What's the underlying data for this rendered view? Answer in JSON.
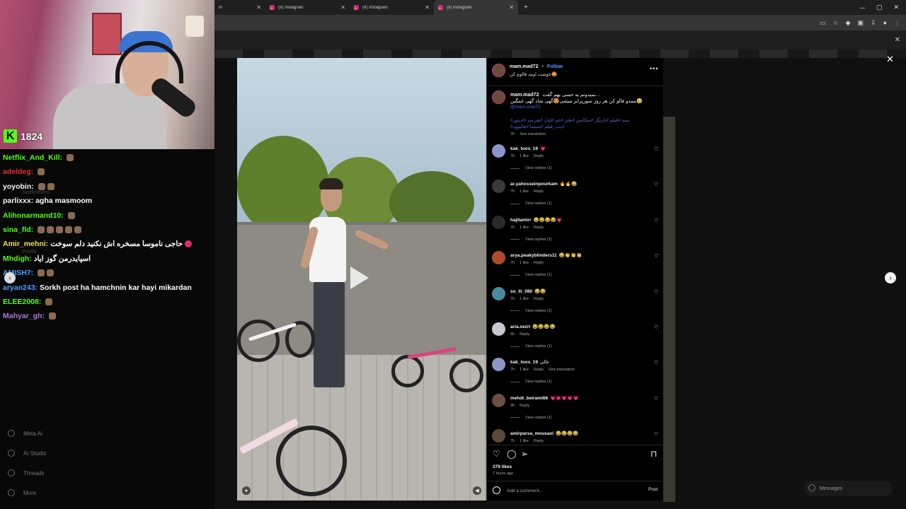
{
  "browser": {
    "tabs": [
      {
        "label": "m",
        "active": false
      },
      {
        "label": "(9) Instagram",
        "active": false
      },
      {
        "label": "(9) Instagram",
        "active": false
      },
      {
        "label": "(9) Instagram",
        "active": true
      }
    ],
    "tab_close": "✕",
    "new_tab": "+",
    "window_controls": [
      "─",
      "▢",
      "✕"
    ]
  },
  "stream": {
    "viewer_count": "1824",
    "chat": [
      {
        "user": "Netflix_And_Kill:",
        "message": "",
        "color": "#53fc18"
      },
      {
        "user": "adeldeg:",
        "message": "",
        "color": "#e03030"
      },
      {
        "user": "yoyobin:",
        "message": "",
        "color": "#f5f5f5"
      },
      {
        "user": "parlixxx:",
        "message": "agha masmoom",
        "color": "#f5f5f5"
      },
      {
        "user": "Alihonarmand10:",
        "message": "",
        "color": "#53fc18"
      },
      {
        "user": "sina_fld:",
        "message": "",
        "color": "#53fc18"
      },
      {
        "user": "Amir_mehni:",
        "message": "حاجی ناموسا مسخره اش نکنید دلم سوخت",
        "color": "#f0e060"
      },
      {
        "user": "Mhdigh:",
        "message": "اسپایدرمن گوز ایاد",
        "color": "#53fc18"
      },
      {
        "user": "AMISH7:",
        "message": "",
        "color": "#4a9dff"
      },
      {
        "user": "aryan243:",
        "message": "Sorkh post ha hamchnin kar hayi mikardan",
        "color": "#4a9dff"
      },
      {
        "user": "ELEE2008:",
        "message": "",
        "color": "#53fc18"
      },
      {
        "user": "Mahyar_gh:",
        "message": "",
        "color": "#b07ad8"
      }
    ],
    "ghost_nav": [
      "Meta AI",
      "AI Studio",
      "Threads",
      "More"
    ],
    "ghost_labels": [
      "Notifications",
      "Profile"
    ]
  },
  "post": {
    "username": "mam.mad72",
    "follow": "Follow",
    "separator": "•",
    "subtitle": "خوشت اومد فالوم کن🤩",
    "caption": {
      "user": "mam.mad72",
      "line1": "نمیدونم یه حسی بهم گفت...",
      "line2": "ممدو فالو کن هر روز سورپرایز میشی😍گهی شاد گهی غمگین🥹",
      "mention": "@mam.mad72",
      "hashtags1": "#ممد #فیلم #بازیگر #سکانس #طنز #غم #لبان #هنرمند #ادیتور",
      "hashtags2": "#ادیت_فیلم #سینما #هالیوود",
      "time": "7h",
      "see_translation": "See translation"
    },
    "comments": [
      {
        "user": "kak_toos_19",
        "text": "💗",
        "time": "7h",
        "likes": "1 like",
        "reply": "Reply",
        "translate": "",
        "view_replies": "View replies (1)"
      },
      {
        "user": "ar.yahosseinpourkam",
        "text": "🔥🔥😂",
        "time": "7h",
        "likes": "1 like",
        "reply": "Reply",
        "translate": "",
        "view_replies": "View replies (1)"
      },
      {
        "user": "hajitamirr",
        "text": "😂😂😂😂💗",
        "time": "7h",
        "likes": "1 like",
        "reply": "Reply",
        "translate": "",
        "view_replies": "View replies (1)"
      },
      {
        "user": "arya.peakyblinders11",
        "text": "😂👏👏👏",
        "time": "7h",
        "likes": "1 like",
        "reply": "Reply",
        "translate": "",
        "view_replies": "View replies (1)"
      },
      {
        "user": "so_lii_080",
        "text": "😂😂",
        "time": "7h",
        "likes": "1 like",
        "reply": "Reply",
        "translate": "",
        "view_replies": "View replies (1)"
      },
      {
        "user": "aria.xezri",
        "text": "😂😂😂😂",
        "time": "6h",
        "likes": "",
        "reply": "Reply",
        "translate": "",
        "view_replies": "View replies (1)"
      },
      {
        "user": "kak_toos_19",
        "text": "عالی",
        "time": "7h",
        "likes": "1 like",
        "reply": "Reply",
        "translate": "See translation",
        "view_replies": "View replies (1)"
      },
      {
        "user": "mehdi_beirami66",
        "text": "💗💗💗💗💗",
        "time": "3h",
        "likes": "",
        "reply": "Reply",
        "translate": "",
        "view_replies": "View replies (1)"
      },
      {
        "user": "amirparsa_mousavi",
        "text": "😂😂😂😂",
        "time": "7h",
        "likes": "1 like",
        "reply": "Reply",
        "translate": "",
        "view_replies": ""
      }
    ],
    "likes": "379 likes",
    "ago": "7 hours ago",
    "add_comment_placeholder": "Add a comment...",
    "post_button": "Post",
    "icons": [
      "heart-icon",
      "comment-icon",
      "share-icon",
      "bookmark-icon"
    ]
  },
  "background": {
    "messages_label": "Messages"
  },
  "colors": {
    "instagram_blue": "#4a9dff",
    "kick_green": "#53fc18"
  }
}
